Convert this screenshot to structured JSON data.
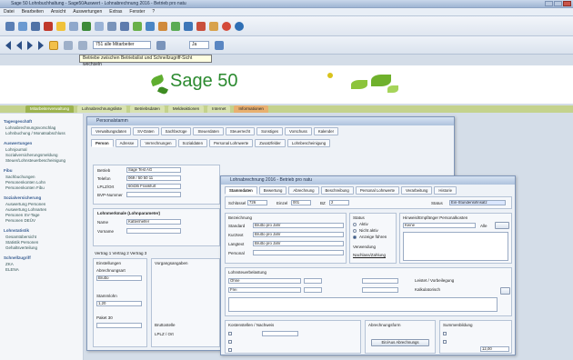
{
  "window": {
    "title": "Sage 50 Lohnbuchhaltung - Sage50Auswert - Lohnabrechnung 2016 - Betrieb pro natu"
  },
  "menubar": {
    "items": [
      "Datei",
      "Bearbeiten",
      "Ansicht",
      "Auswertungen",
      "Extras",
      "Fenster",
      "?"
    ]
  },
  "toolbar2": {
    "combo_value": "751 alle Mitarbeiter",
    "field_value": "Ja"
  },
  "tooltip": "Betriebe zwischen Betriebslist und Schnellzugriff-Sicht wechseln",
  "brand": {
    "name": "Sage 50"
  },
  "main_tabs": [
    {
      "label": "Mitarbeiterverwaltung"
    },
    {
      "label": "Lohnabrechnungsliste"
    },
    {
      "label": "Betriebsdaten"
    },
    {
      "label": "Meldeaktionen"
    },
    {
      "label": "Internet"
    },
    {
      "label": "Informationen"
    }
  ],
  "sidebar": {
    "sections": [
      {
        "title": "Tagesgeschäft",
        "items": [
          "Lohnabrechnungsvorschlag",
          "Lohnbuchung / Monatsabschluss"
        ]
      },
      {
        "title": "Auswertungen",
        "items": [
          "Lohnjournal",
          "Sozialversicherungsmeldung",
          "Steuer/Lohnsteuerbescheinigung"
        ]
      },
      {
        "title": "Fibu",
        "items": [
          "Sachbuchungen",
          "Personenkonten Lohn",
          "Personenkonten Fibu"
        ]
      },
      {
        "title": "Sozialversicherung",
        "items": [
          "Auswertung Personen",
          "Auswertung Lohnarten",
          "Personen SV-Tage",
          "Personen DEÜV"
        ]
      },
      {
        "title": "Lohnstatistik",
        "items": [
          "Gesamtübersicht",
          "Statistik Personen",
          "Gehaltsverteilung"
        ]
      },
      {
        "title": "Schnellzugriff",
        "items": [
          "ZKA",
          "ELENA"
        ]
      }
    ]
  },
  "win1": {
    "title": "Personalstamm",
    "tabs_row1": [
      "Verwaltungsdaten",
      "SV-Daten",
      "Sachbezüge",
      "Steuerdaten",
      "Steuerrecht",
      "Sonstiges",
      "Vorschuss",
      "Kalender"
    ],
    "tabs_row2": [
      "Person",
      "Adresse",
      "Verrechnungen",
      "Sozialdaten",
      "Personal Lohnwerte",
      "Zusatzfelder",
      "Lohnbescheinigung"
    ],
    "fields": {
      "betrieb_label": "Betrieb",
      "betrieb_value": "Sage Test AG",
      "telefon_label": "Telefon",
      "telefon_value": "069 / 50 50 11",
      "plz_label": "LPLZ/Ort",
      "plz_value": "60436 Frankfurt",
      "bvp_label": "BVP-Nummer",
      "section_label": "Lohnmerkmale (Lohnparameter)",
      "name_label": "Name",
      "name_value": "Kattenhelfer",
      "vorname_label": "Vorname",
      "vertrag_label": "Vertrag 1  Vertrag 2  Vertrag 3",
      "einstell_label": "Einstellungen",
      "abrechnung_label": "Abrechnungsart",
      "abrechnung_value": "Brutto",
      "vorgangs_label": "Vorgangsangaben",
      "stammlohn_label": "Stammlohn",
      "lohnart_value": "1,20",
      "paket_label": "Paket 30",
      "bruttostelle": "Bruttostelle",
      "lplz": "LPLZ / Ort"
    }
  },
  "win2": {
    "title": "Lohnabrechnung 2016 - Betrieb pro natu",
    "tabs": [
      "Stammdaten",
      "Bewertung",
      "Abrechnung",
      "Beschreibung",
      "Personal Lohnwerte",
      "Verarbeitung",
      "Historie"
    ],
    "fields": {
      "schluessel_label": "Schlüssel",
      "schluessel_value": "726",
      "einzel_label": "Einzel",
      "einzel_value": "001",
      "bz_label": "BZ",
      "bz_value": "2",
      "status_label": "Status",
      "status_value": "Ein-Stundenlohnsatz",
      "bezeichnung_label": "Bezeichnung",
      "standard_label": "Standard",
      "standard_value": "Brutto pro Jahr",
      "kurztext_label": "Kurztext",
      "kurztext_value": "Brutto pro Jahr",
      "langtext_label": "Langtext",
      "langtext_value": "Brutto pro Jahr",
      "personal_label": "Personal",
      "status2_label": "Status",
      "opt1": "Aktiv",
      "opt2": "Nicht aktiv",
      "opt3": "Anzeige führen",
      "verwendung_label": "Verwendung",
      "verwendung_value": "Nachlass/Zahlung",
      "hinweise_label": "Hinweis/Empfänger Personalkosten",
      "keine_label": "Keine",
      "keine_value": "Alle",
      "lohnsteuer_label": "Lohnsteuerbelastung",
      "lohnart_value1": "Ohne",
      "lohnart_value2": "Frei",
      "note1": "Leistet / Vorbeilegung",
      "note2": "Kalkulatorisch",
      "bottom_label1": "Kostenstellen / Nachweis",
      "bottom_label2": "Kostenträger",
      "lohnform_label": "Abrechnungsform",
      "btn_abrechnung": "Ein/Aus Abrechnungs",
      "summe_label": "Summenbildung",
      "summe_value": "12,00"
    }
  },
  "colors": {
    "accent": "#2b8a2f",
    "tabbar": "#c4d28d"
  }
}
